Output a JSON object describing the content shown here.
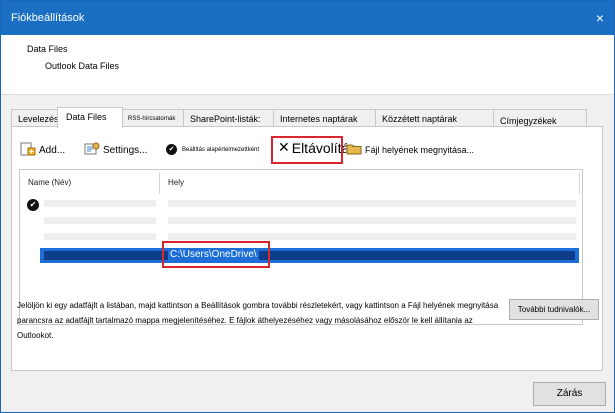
{
  "window": {
    "title": "Fiókbeállítások",
    "close_glyph": "×"
  },
  "header": {
    "title": "Data Files",
    "subtitle": "Outlook Data Files"
  },
  "tabs": [
    {
      "label": "Levelezés"
    },
    {
      "label": "Data Files"
    },
    {
      "label": "RSS-hírcsatornák"
    },
    {
      "label": "SharePoint-listák:"
    },
    {
      "label": "Internetes naptárak"
    },
    {
      "label": "Közzétett naptárak"
    },
    {
      "label": "Címjegyzékek"
    }
  ],
  "toolbar": {
    "add": "Add...",
    "settings": "Settings...",
    "set_default": "Beállítás alapértelmezettként",
    "remove": "Eltávolítás",
    "open_location": "Fájl helyének megnyitása..."
  },
  "list": {
    "col_name": "Name (Név)",
    "col_location": "Hely",
    "selected_path": "C:\\Users\\OneDrive\\"
  },
  "description": "Jelöljön ki egy adatfájlt a listában, majd kattintson a Beállítások gombra további részletekért, vagy kattintson a Fájl helyének megnyitása parancsra az adatfájlt tartalmazó mappa megjelenítéséhez. E fájlok áthelyezéséhez vagy másolásához először le kell állítania az Outlookot.",
  "buttons": {
    "more_info": "További tudnivalók...",
    "close": "Zárás"
  },
  "icons": {
    "add": "add-file-icon",
    "settings": "settings-icon",
    "default": "checkmark-circle-icon",
    "remove": "x-icon",
    "open": "folder-icon"
  }
}
